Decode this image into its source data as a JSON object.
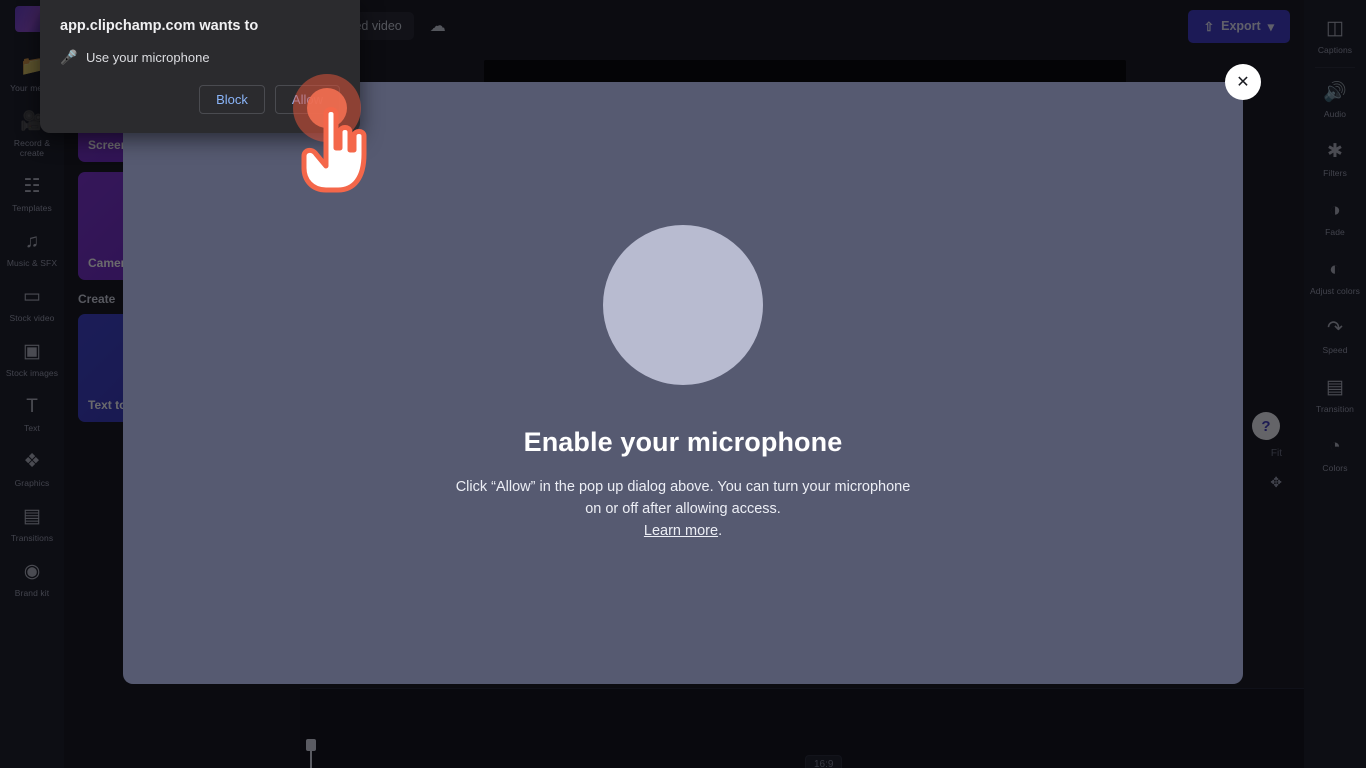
{
  "app": {
    "logo_name": "clipchamp-logo"
  },
  "topbar": {
    "project_name": "Untitled video",
    "save_icon": "cloud-save-icon",
    "export_label": "Export",
    "export_icon": "export-upload-icon",
    "export_chevron": "chevron-down-icon",
    "export_color": "#3c37c9"
  },
  "left_rail": {
    "items": [
      {
        "label": "Your media",
        "icon": "media-folder-icon"
      },
      {
        "label": "Record & create",
        "icon": "video-camera-icon"
      },
      {
        "label": "Templates",
        "icon": "templates-icon"
      },
      {
        "label": "Music & SFX",
        "icon": "music-note-icon"
      },
      {
        "label": "Stock video",
        "icon": "stock-video-icon"
      },
      {
        "label": "Stock images",
        "icon": "stock-image-icon"
      },
      {
        "label": "Text",
        "icon": "text-icon"
      },
      {
        "label": "Graphics",
        "icon": "graphics-icon"
      },
      {
        "label": "Transitions",
        "icon": "transitions-icon"
      },
      {
        "label": "Brand kit",
        "icon": "brand-kit-icon"
      }
    ]
  },
  "content_panel": {
    "cards": [
      {
        "label": "Screen",
        "name": "screen-record-card"
      },
      {
        "label": "Camera",
        "name": "camera-record-card"
      }
    ],
    "section_title": "Create",
    "create_cards": [
      {
        "label": "Text to speech",
        "name": "text-to-speech-card"
      }
    ]
  },
  "right_rail": {
    "items": [
      {
        "label": "Captions",
        "icon": "captions-icon"
      },
      {
        "label": "Audio",
        "icon": "audio-speaker-icon"
      },
      {
        "label": "Filters",
        "icon": "filters-icon"
      },
      {
        "label": "Fade",
        "icon": "fade-icon"
      },
      {
        "label": "Adjust colors",
        "icon": "adjust-colors-icon"
      },
      {
        "label": "Speed",
        "icon": "speed-icon"
      },
      {
        "label": "Transition",
        "icon": "transition-icon"
      },
      {
        "label": "Colors",
        "icon": "color-palette-icon"
      }
    ]
  },
  "canvas_controls": {
    "help_label": "?",
    "help_icon": "help-question-icon",
    "zoom_label": "Fit",
    "expand_icon": "expand-fullscreen-icon"
  },
  "timeline": {
    "ratio_badge": "16:9",
    "playhead_name": "timeline-playhead"
  },
  "mic_modal": {
    "title": "Enable your microphone",
    "body_line1": "Click “Allow” in the pop up dialog above.  You can turn your",
    "body_line2": "microphone on or off after allowing access.",
    "link_label": "Learn more",
    "link_suffix": ".",
    "close_icon": "close-x-icon",
    "avatar_icon": "microphone-placeholder-circle",
    "background_color": "#565a71",
    "circle_color": "#b8bbd0"
  },
  "permission_popup": {
    "title": "app.clipchamp.com wants to",
    "permission_icon": "microphone-icon",
    "permission_text": "Use your microphone",
    "block_label": "Block",
    "allow_label": "Allow",
    "link_color": "#8ab4f8"
  },
  "cursor": {
    "name": "hand-pointer-cursor",
    "ripple_color": "#ee6e50"
  }
}
